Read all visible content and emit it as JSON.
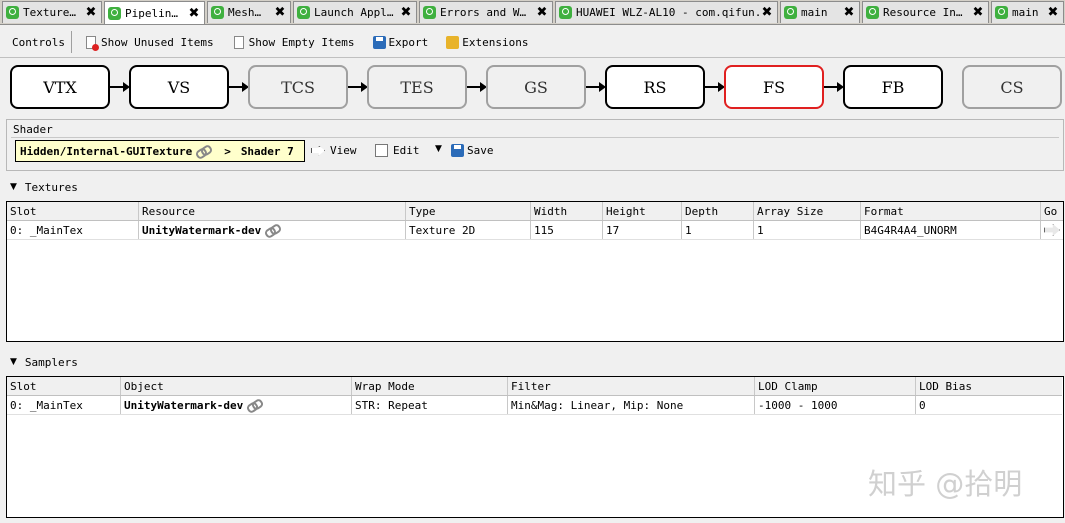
{
  "tabs": [
    {
      "label": "Texture…",
      "active": false,
      "icon": "renderdoc-icon"
    },
    {
      "label": "Pipelin…",
      "active": true,
      "icon": "renderdoc-icon"
    },
    {
      "label": "Mesh…",
      "active": false,
      "icon": "renderdoc-icon"
    },
    {
      "label": "Launch Appl…",
      "active": false,
      "icon": "renderdoc-icon"
    },
    {
      "label": "Errors and W…",
      "active": false,
      "icon": "renderdoc-icon"
    },
    {
      "label": "HUAWEI WLZ-AL10 - com.qifun.…",
      "active": false,
      "icon": "renderdoc-icon"
    },
    {
      "label": "main",
      "active": false,
      "icon": "renderdoc-icon"
    },
    {
      "label": "Resource In…",
      "active": false,
      "icon": "renderdoc-icon"
    },
    {
      "label": "main",
      "active": false,
      "icon": "renderdoc-icon"
    }
  ],
  "tab_close_glyph": "✖",
  "toolbar": {
    "controls_label": "Controls",
    "show_unused": "Show Unused Items",
    "show_empty": "Show Empty Items",
    "export": "Export",
    "extensions": "Extensions"
  },
  "pipeline": {
    "stages": [
      {
        "label": "VTX",
        "state": "enabled"
      },
      {
        "label": "VS",
        "state": "enabled"
      },
      {
        "label": "TCS",
        "state": "disabled"
      },
      {
        "label": "TES",
        "state": "disabled"
      },
      {
        "label": "GS",
        "state": "disabled"
      },
      {
        "label": "RS",
        "state": "enabled"
      },
      {
        "label": "FS",
        "state": "selected"
      },
      {
        "label": "FB",
        "state": "enabled"
      },
      {
        "label": "CS",
        "state": "disabled"
      }
    ],
    "selected_color": "#e02020"
  },
  "shader": {
    "title": "Shader",
    "path": "Hidden/Internal-GUITexture",
    "separator": ">",
    "path_tail": "Shader 7",
    "view": "View",
    "edit": "Edit",
    "save": "Save"
  },
  "textures": {
    "title": "Textures",
    "columns": [
      "Slot",
      "Resource",
      "Type",
      "Width",
      "Height",
      "Depth",
      "Array Size",
      "Format",
      "Go"
    ],
    "rows": [
      {
        "slot": "0: _MainTex",
        "resource": "UnityWatermark-dev",
        "type": "Texture 2D",
        "width": "115",
        "height": "17",
        "depth": "1",
        "array_size": "1",
        "format": "B4G4R4A4_UNORM"
      }
    ]
  },
  "samplers": {
    "title": "Samplers",
    "columns": [
      "Slot",
      "Object",
      "Wrap Mode",
      "Filter",
      "LOD Clamp",
      "LOD Bias"
    ],
    "rows": [
      {
        "slot": "0: _MainTex",
        "object": "UnityWatermark-dev",
        "wrap_mode": "STR: Repeat",
        "filter": "Min&Mag: Linear, Mip: None",
        "lod_clamp": "-1000 - 1000",
        "lod_bias": "0"
      }
    ]
  },
  "watermark": "知乎 @拾明"
}
